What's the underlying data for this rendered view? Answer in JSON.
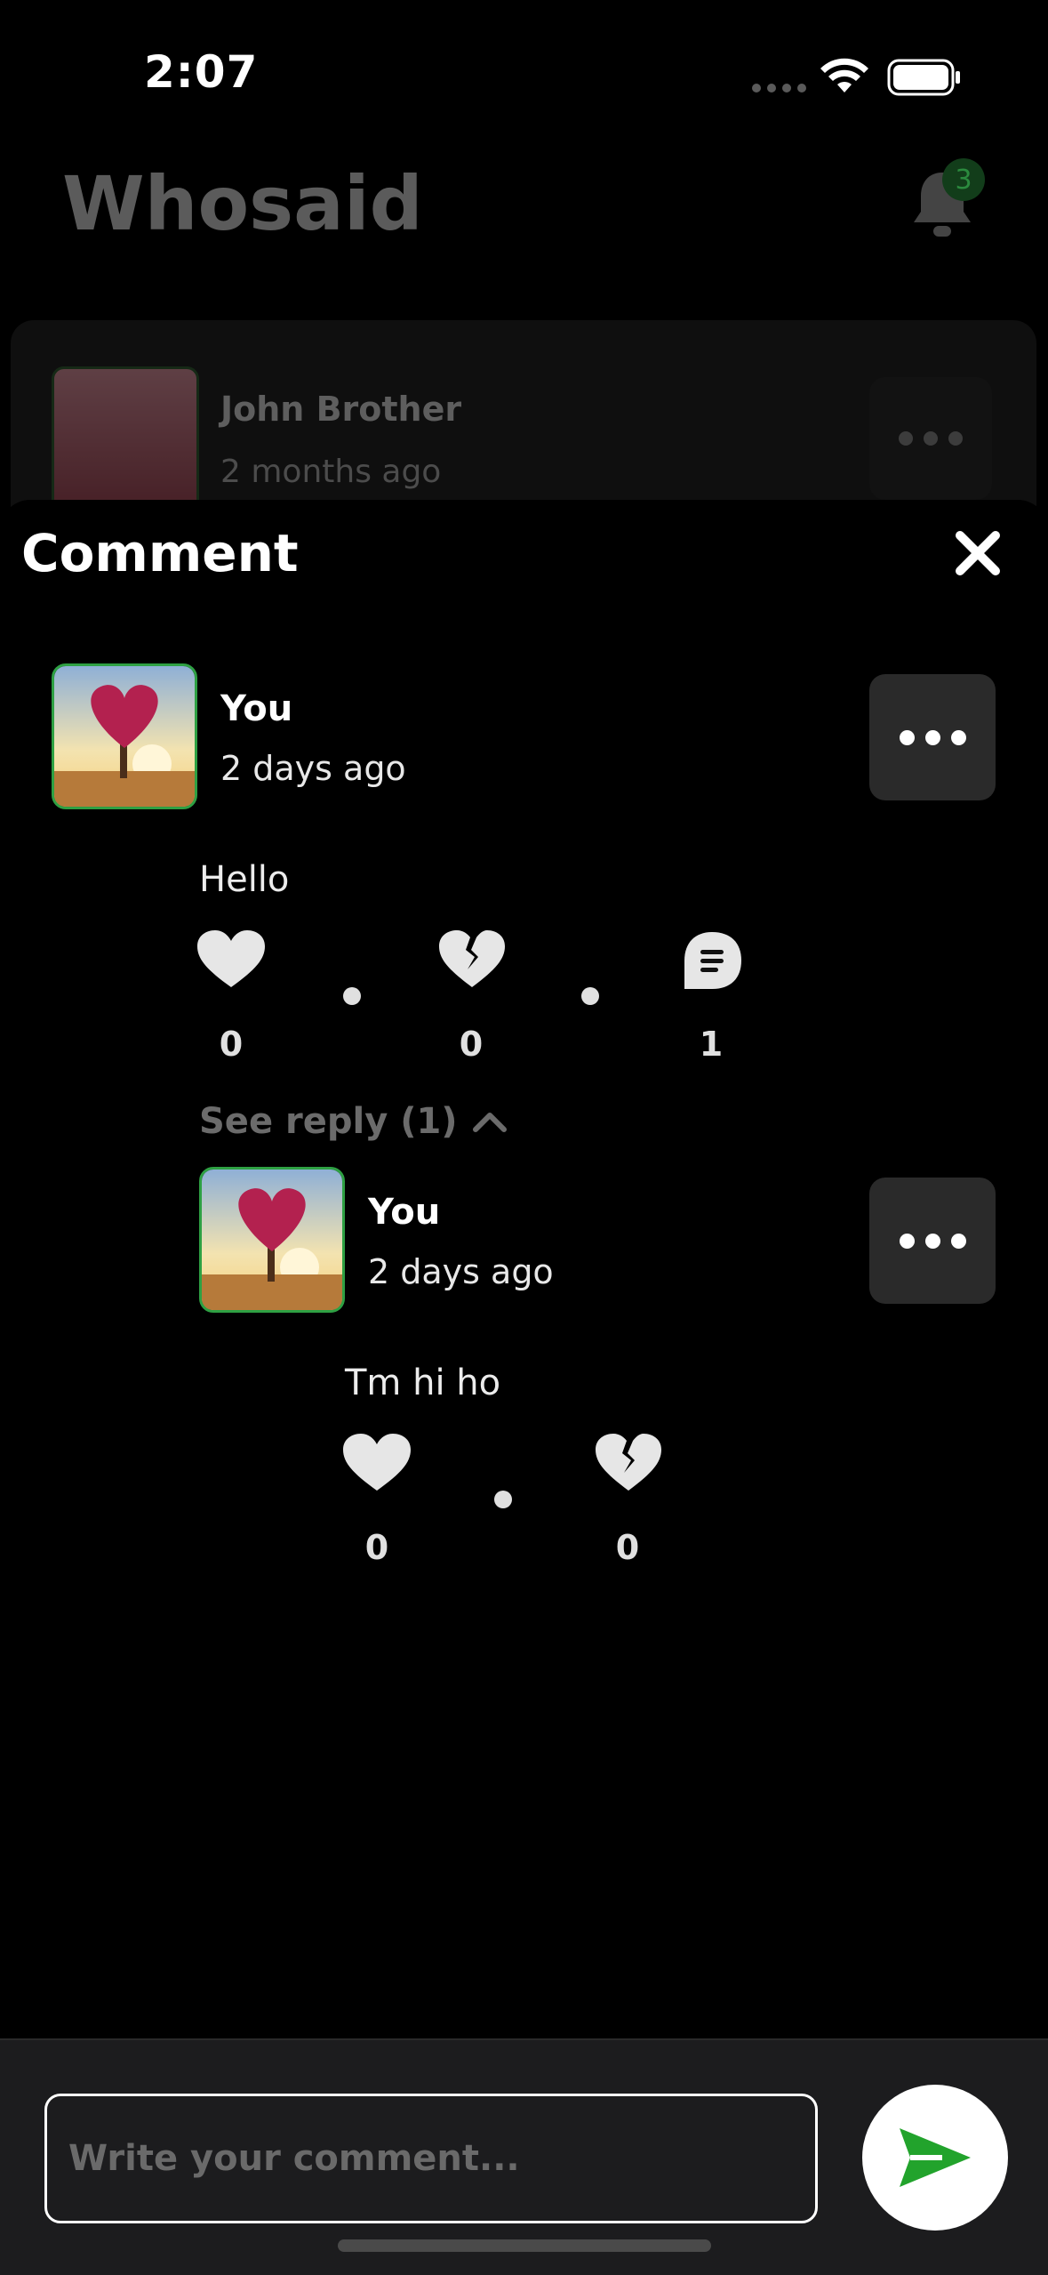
{
  "status_bar": {
    "time": "2:07"
  },
  "background": {
    "app_title": "Whosaid",
    "notification_count": "3",
    "feed_post": {
      "name": "John Brother",
      "time": "2 months ago"
    }
  },
  "sheet": {
    "title": "Comment",
    "comment": {
      "author": "You",
      "time": "2 days ago",
      "text": "Hello",
      "likes": "0",
      "dislikes": "0",
      "replies": "1"
    },
    "see_reply_label": "See reply (1)",
    "reply": {
      "author": "You",
      "time": "2 days ago",
      "text": "Tm hi ho",
      "likes": "0",
      "dislikes": "0"
    }
  },
  "composer": {
    "placeholder": "Write your comment..."
  },
  "colors": {
    "accent": "#2ea043",
    "send_icon": "#22a32c",
    "background": "#000000"
  }
}
